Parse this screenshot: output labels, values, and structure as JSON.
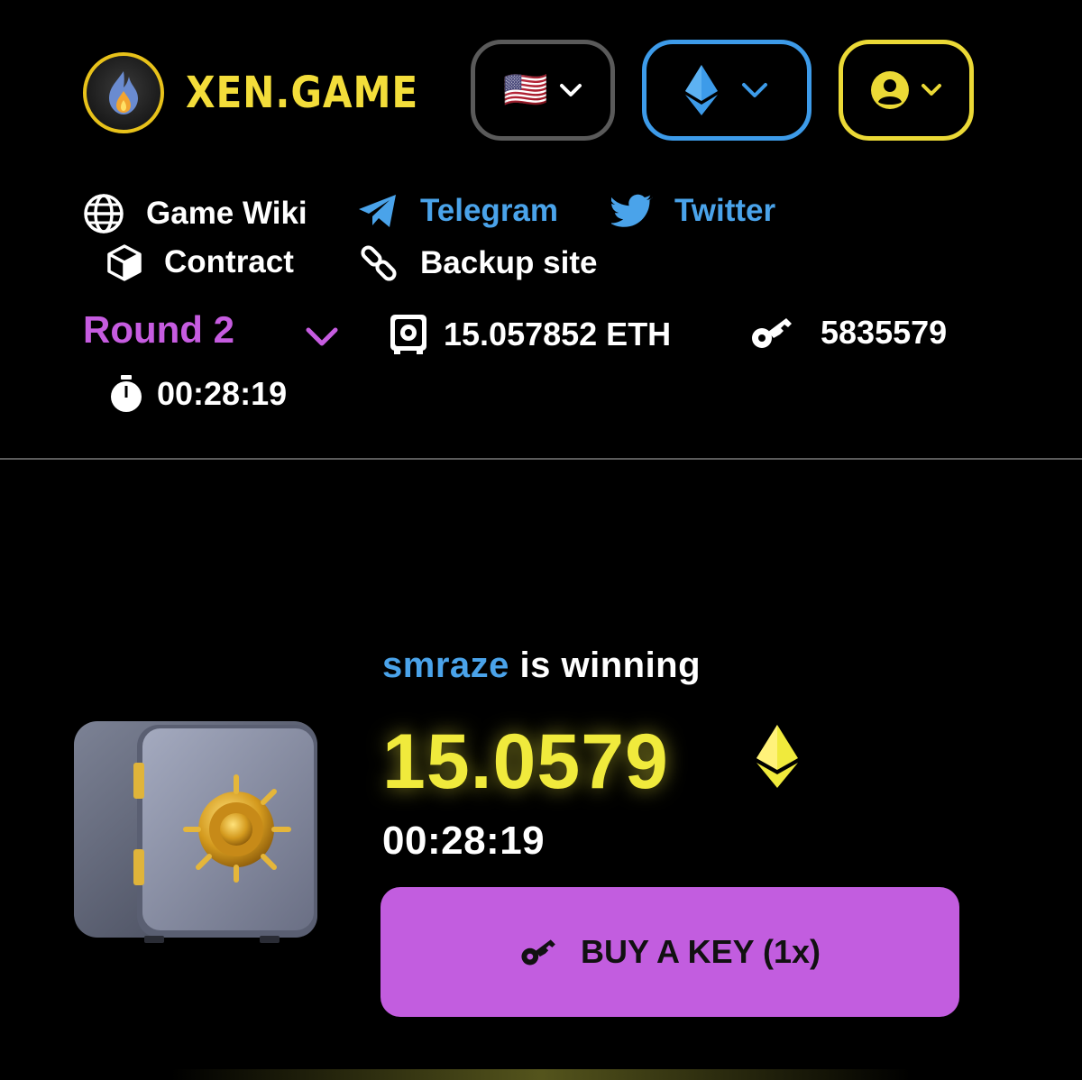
{
  "header": {
    "brand": "XEN.GAME",
    "language_flag": "🇺🇸"
  },
  "links": {
    "game_wiki": "Game Wiki",
    "telegram": "Telegram",
    "twitter": "Twitter",
    "contract": "Contract",
    "backup_site": "Backup site"
  },
  "round": {
    "label": "Round 2",
    "pot": "15.057852 ETH",
    "keys": "5835579",
    "timer": "00:28:19"
  },
  "main": {
    "winner_name": "smraze",
    "winner_suffix": "is winning",
    "pot_amount": "15.0579",
    "timer": "00:28:19",
    "buy_button_label": "BUY A KEY (1x)"
  },
  "colors": {
    "brand_yellow": "#f3dd3a",
    "link_blue": "#4aa3ea",
    "round_purple": "#c65ce0",
    "button_purple": "#c25ddf",
    "pot_yellow": "#f0ea3c",
    "network_border": "#3d9be9",
    "user_border": "#ebd936"
  }
}
